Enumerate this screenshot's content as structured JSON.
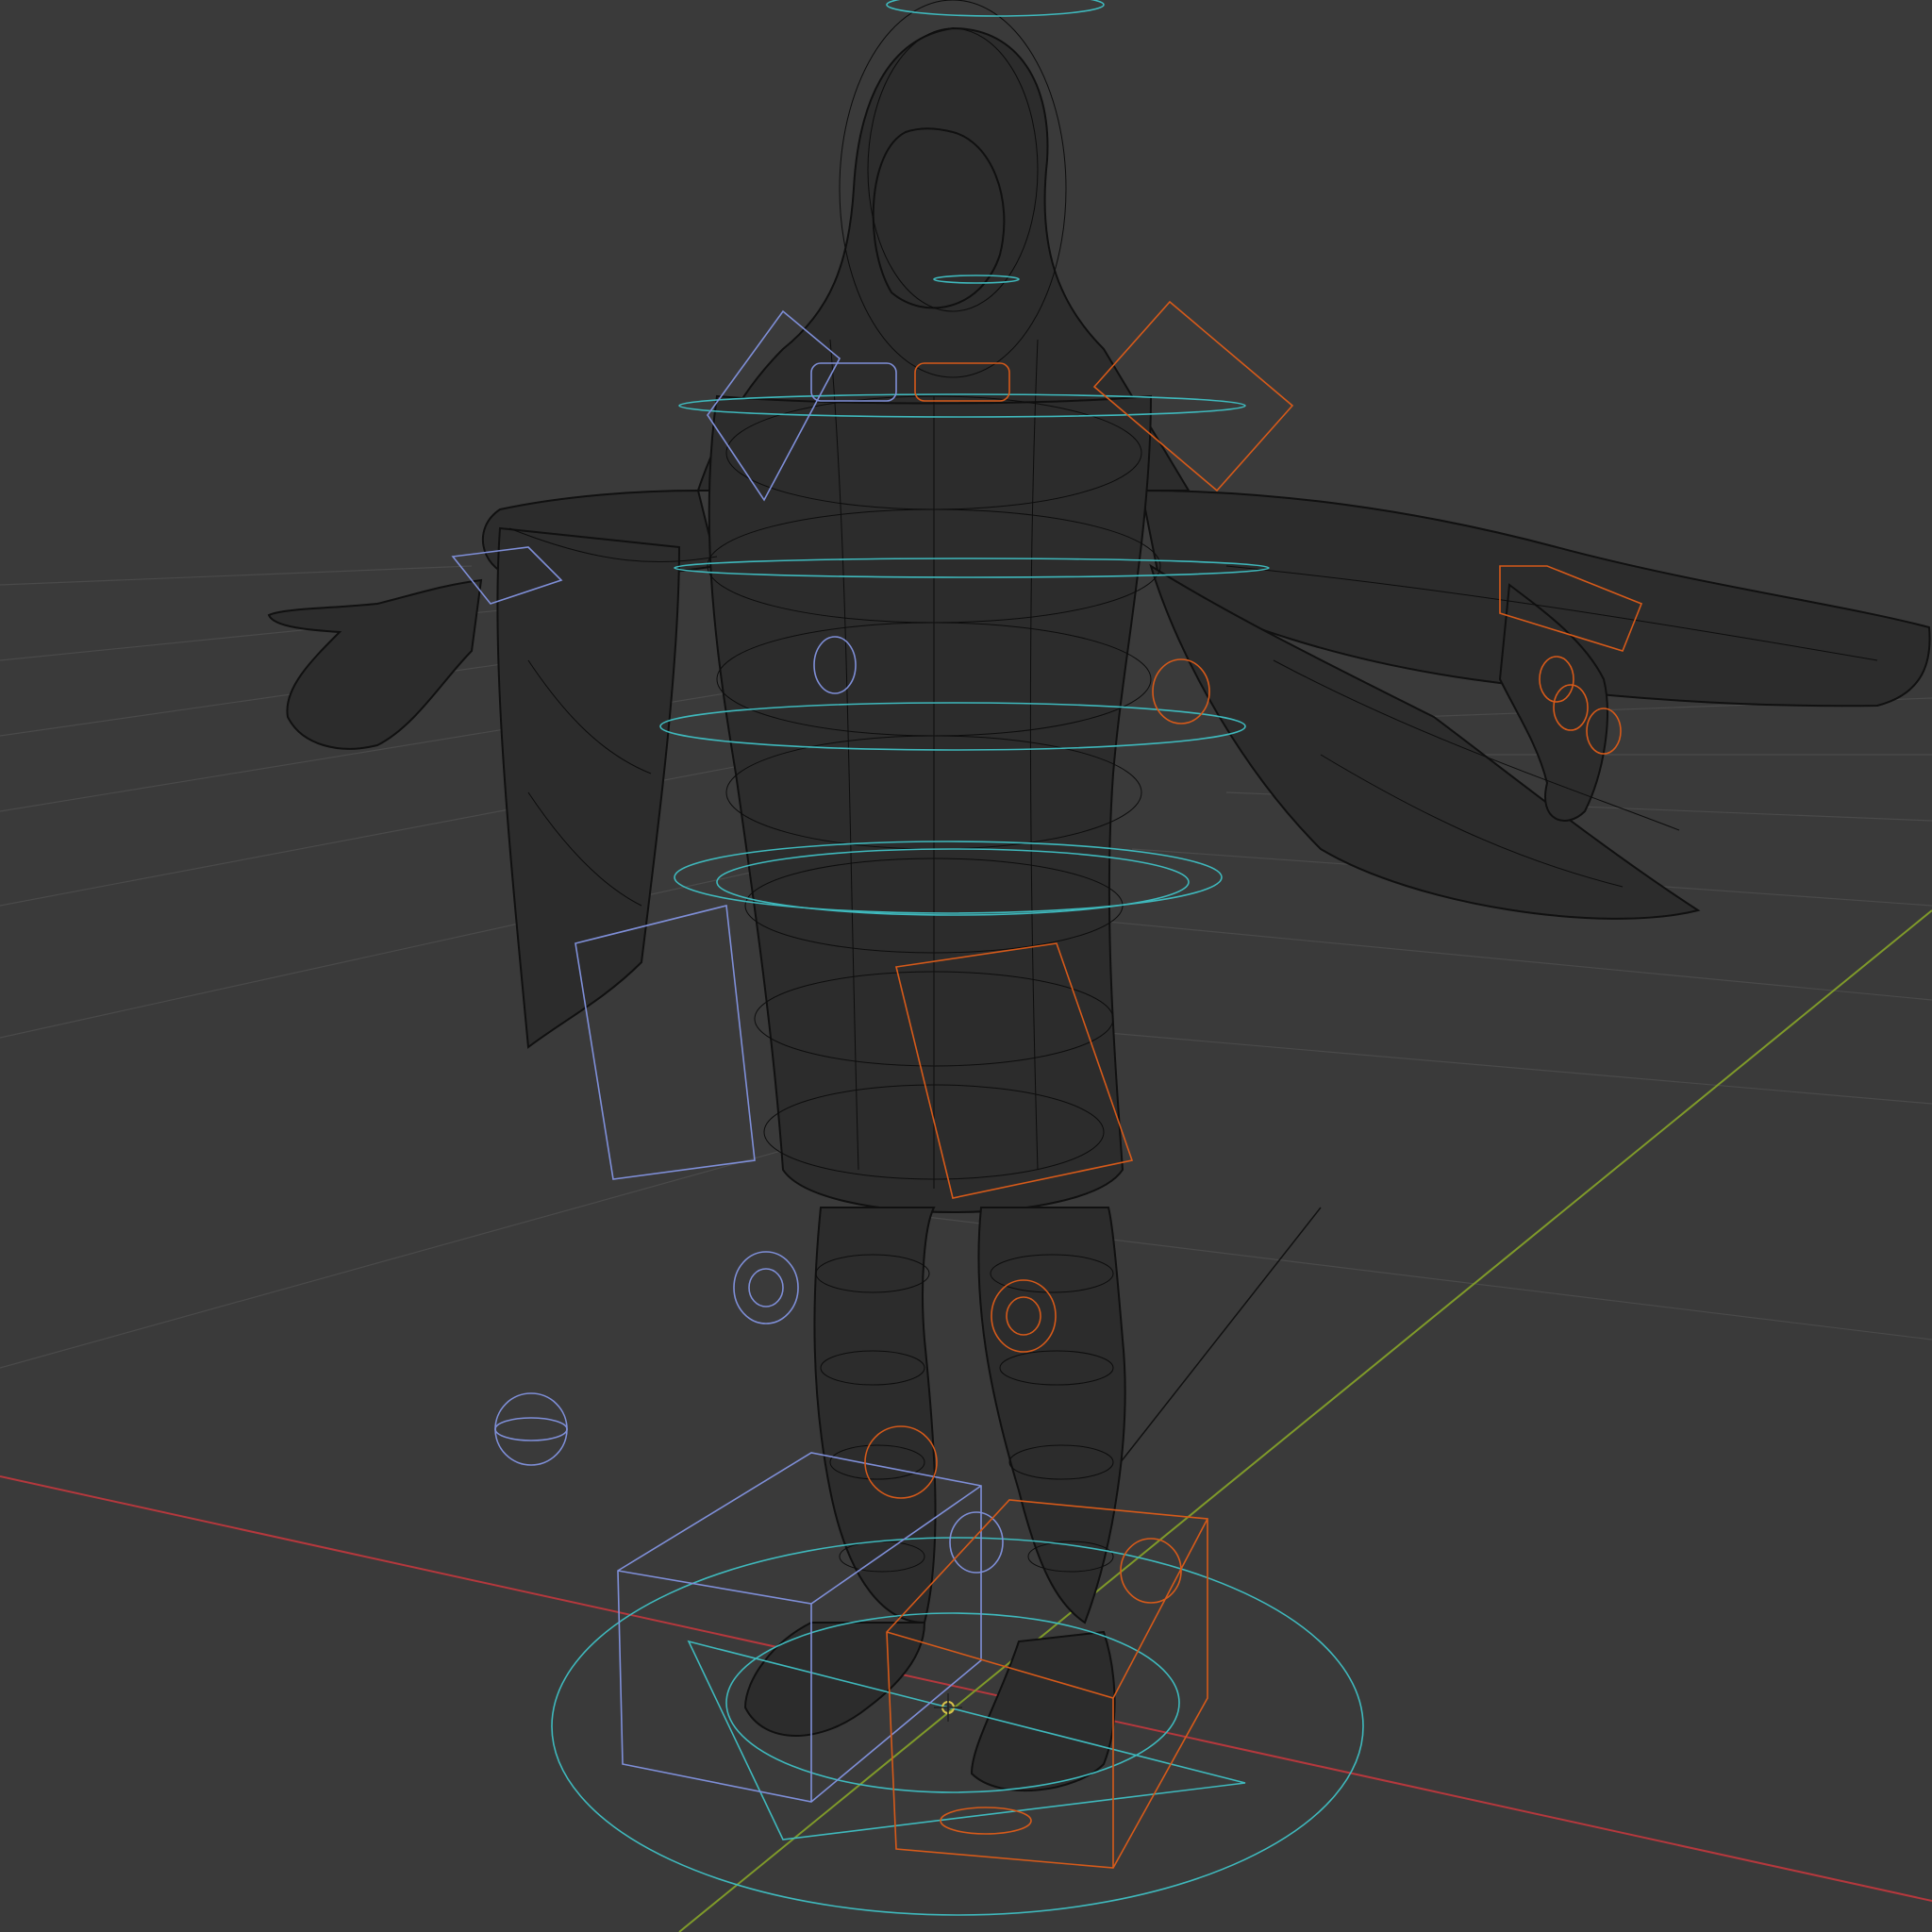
{
  "viewport": {
    "background": "#3a3a3a",
    "display_mode": "wireframe",
    "axis_x_color": "#b5383d",
    "axis_y_color": "#7f9a2a",
    "grid_color": "#4a4a4a",
    "mesh_wire_color": "#0d0d0d"
  },
  "scene": {
    "object": "hooded-robed-character",
    "pose": "T-pose",
    "rig": {
      "control_colors": {
        "center": "#3fb9bd",
        "left_side": "#d65a1a",
        "right_side": "#7f8fd8"
      }
    }
  }
}
